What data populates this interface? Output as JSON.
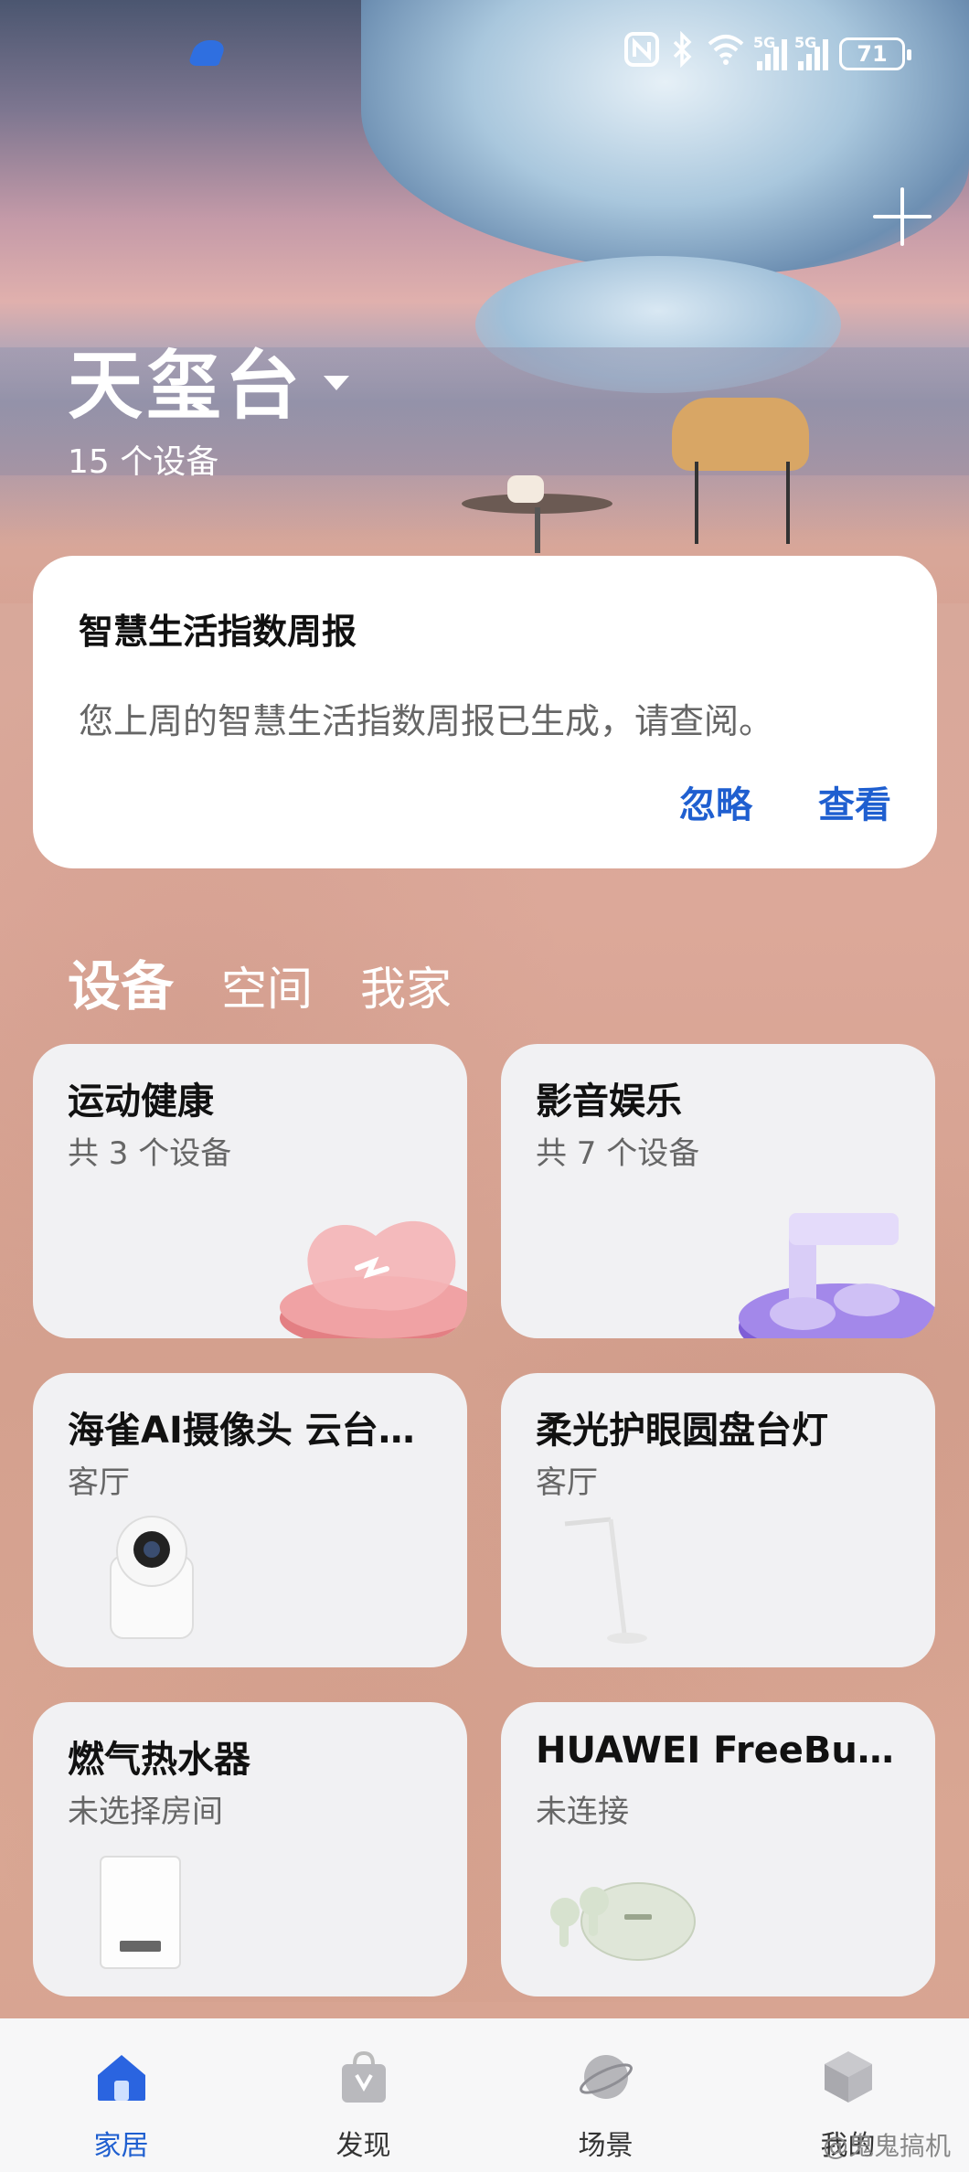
{
  "status_bar": {
    "battery": "71",
    "signal_labels": [
      "5G",
      "5G"
    ],
    "icons": [
      "nfc-icon",
      "bluetooth-icon",
      "wifi-icon",
      "signal-icon",
      "signal-icon",
      "battery-icon"
    ]
  },
  "header": {
    "home_name": "天玺台",
    "device_count": "15 个设备"
  },
  "notice": {
    "title": "智慧生活指数周报",
    "body": "您上周的智慧生活指数周报已生成，请查阅。",
    "ignore_label": "忽略",
    "view_label": "查看"
  },
  "tabs": [
    {
      "label": "设备",
      "active": true
    },
    {
      "label": "空间",
      "active": false
    },
    {
      "label": "我家",
      "active": false
    }
  ],
  "cards": [
    {
      "title": "运动健康",
      "subtitle": "共 3 个设备",
      "icon": "health-heart-icon"
    },
    {
      "title": "影音娱乐",
      "subtitle": "共 7 个设备",
      "icon": "music-note-icon"
    },
    {
      "title": "海雀AI摄像头 云台…",
      "subtitle": "客厅",
      "icon": "camera-icon"
    },
    {
      "title": "柔光护眼圆盘台灯",
      "subtitle": "客厅",
      "icon": "desk-lamp-icon"
    },
    {
      "title": "燃气热水器",
      "subtitle": "未选择房间",
      "icon": "water-heater-icon"
    },
    {
      "title": "HUAWEI FreeBud…",
      "subtitle": "未连接",
      "icon": "earbuds-icon"
    }
  ],
  "bottom_nav": [
    {
      "label": "家居",
      "icon": "home-icon",
      "active": true
    },
    {
      "label": "发现",
      "icon": "shopping-bag-icon",
      "active": false
    },
    {
      "label": "场景",
      "icon": "planet-icon",
      "active": false
    },
    {
      "label": "我的",
      "icon": "cube-icon",
      "active": false
    }
  ],
  "watermark": "@鬼鬼搞机",
  "colors": {
    "accent": "#1f5fd0",
    "card_bg": "#f1f1f3",
    "nav_bg": "#f7f7f8"
  }
}
